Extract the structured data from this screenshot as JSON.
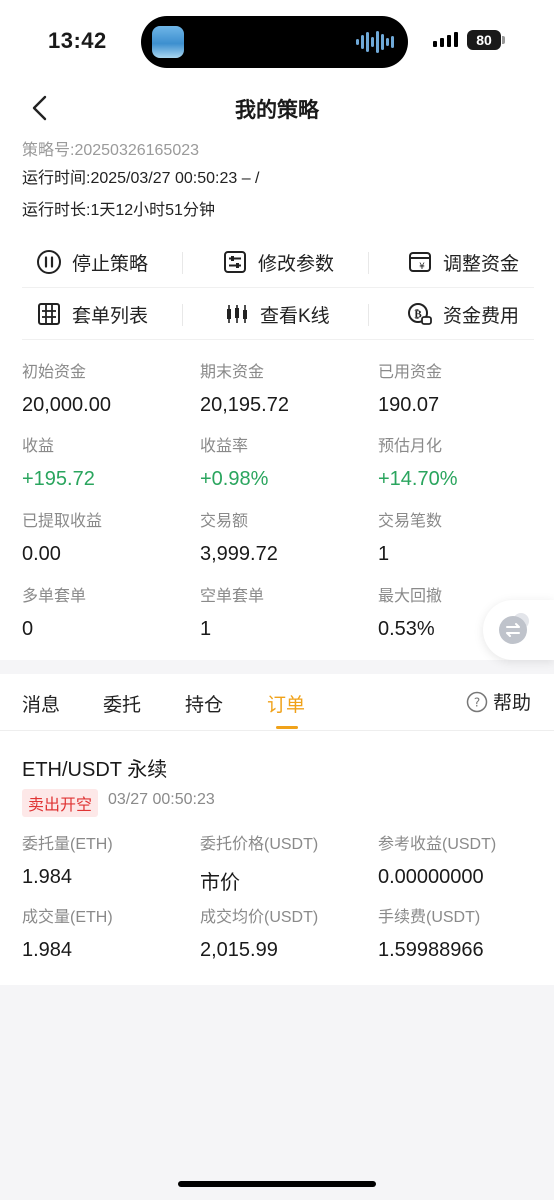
{
  "status_bar": {
    "time": "13:42",
    "battery": "80"
  },
  "nav": {
    "title": "我的策略"
  },
  "strategy": {
    "id_text": "策略号:20250326165023",
    "run_time": "运行时间:2025/03/27 00:50:23 – /",
    "duration": "运行时长:1天12小时51分钟"
  },
  "actions": [
    {
      "label": "停止策略",
      "icon": "pause-circle-icon"
    },
    {
      "label": "修改参数",
      "icon": "sliders-icon"
    },
    {
      "label": "调整资金",
      "icon": "wallet-icon"
    },
    {
      "label": "套单列表",
      "icon": "grid-list-icon"
    },
    {
      "label": "查看K线",
      "icon": "candlestick-icon"
    },
    {
      "label": "资金费用",
      "icon": "coin-fee-icon"
    }
  ],
  "stats": [
    {
      "label": "初始资金",
      "value": "20,000.00"
    },
    {
      "label": "期末资金",
      "value": "20,195.72"
    },
    {
      "label": "已用资金",
      "value": "190.07"
    },
    {
      "label": "收益",
      "value": "+195.72"
    },
    {
      "label": "收益率",
      "value": "+0.98%"
    },
    {
      "label": "预估月化",
      "value": "+14.70%"
    },
    {
      "label": "已提取收益",
      "value": "0.00"
    },
    {
      "label": "交易额",
      "value": "3,999.72"
    },
    {
      "label": "交易笔数",
      "value": "1"
    },
    {
      "label": "多单套单",
      "value": "0"
    },
    {
      "label": "空单套单",
      "value": "1"
    },
    {
      "label": "最大回撤",
      "value": "0.53%"
    }
  ],
  "tabs": [
    {
      "label": "消息"
    },
    {
      "label": "委托"
    },
    {
      "label": "持仓"
    },
    {
      "label": "订单"
    }
  ],
  "help_label": "帮助",
  "order": {
    "pair": "ETH/USDT 永续",
    "side": "卖出开空",
    "time": "03/27 00:50:23",
    "fields": [
      {
        "label": "委托量(ETH)",
        "value": "1.984"
      },
      {
        "label": "委托价格(USDT)",
        "value": "市价"
      },
      {
        "label": "参考收益(USDT)",
        "value": "0.00000000"
      },
      {
        "label": "成交量(ETH)",
        "value": "1.984"
      },
      {
        "label": "成交均价(USDT)",
        "value": "2,015.99"
      },
      {
        "label": "手续费(USDT)",
        "value": "1.59988966"
      }
    ]
  },
  "colors": {
    "accent": "#f0a21a",
    "positive": "#2aa55e",
    "sell": "#e03434"
  }
}
